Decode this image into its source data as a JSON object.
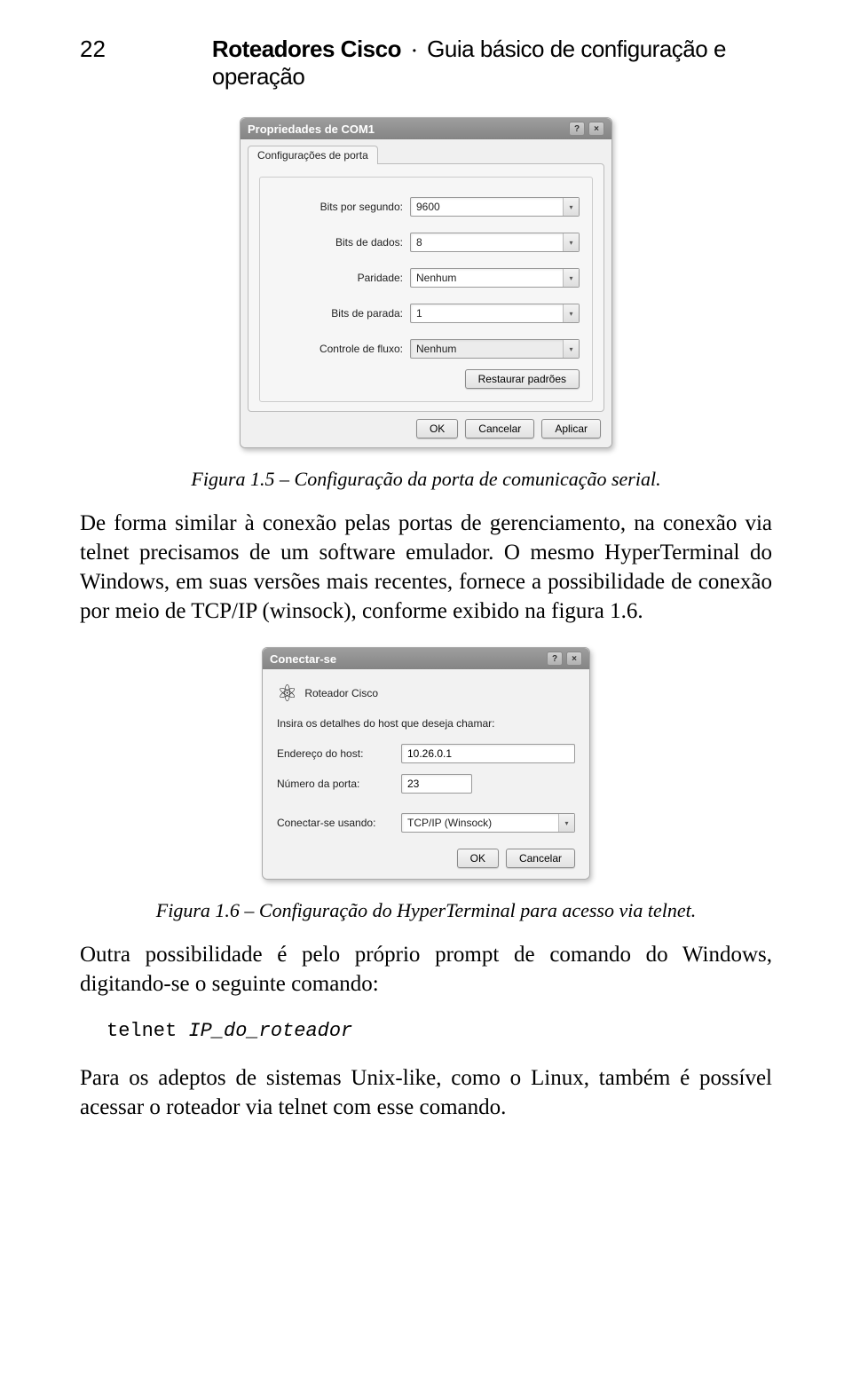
{
  "header": {
    "page_number": "22",
    "book_title_left": "Roteadores Cisco",
    "separator": "•",
    "book_title_right": "Guia básico de configuração e operação"
  },
  "dialog1": {
    "title": "Propriedades de COM1",
    "help_btn": "?",
    "close_btn": "×",
    "tab_label": "Configurações de porta",
    "fields": {
      "bits_per_second_label": "Bits por segundo:",
      "bits_per_second_value": "9600",
      "data_bits_label": "Bits de dados:",
      "data_bits_value": "8",
      "parity_label": "Paridade:",
      "parity_value": "Nenhum",
      "stop_bits_label": "Bits de parada:",
      "stop_bits_value": "1",
      "flow_control_label": "Controle de fluxo:",
      "flow_control_value": "Nenhum"
    },
    "restore_btn": "Restaurar padrões",
    "ok_btn": "OK",
    "cancel_btn": "Cancelar",
    "apply_btn": "Aplicar"
  },
  "caption1": "Figura 1.5 – Configuração da porta de comunicação serial.",
  "para1": "De forma similar à conexão pelas portas de gerenciamento, na conexão via telnet precisamos de um software emulador. O mesmo HyperTerminal do Windows, em suas versões mais recentes, fornece a possibilidade de conexão por meio de TCP/IP (winsock), conforme exibido na figura 1.6.",
  "dialog2": {
    "title": "Conectar-se",
    "help_btn": "?",
    "close_btn": "×",
    "conn_name": "Roteador Cisco",
    "instruction": "Insira os detalhes do host que deseja chamar:",
    "host_label": "Endereço do host:",
    "host_value": "10.26.0.1",
    "port_label": "Número da porta:",
    "port_value": "23",
    "connect_using_label": "Conectar-se usando:",
    "connect_using_value": "TCP/IP (Winsock)",
    "ok_btn": "OK",
    "cancel_btn": "Cancelar"
  },
  "caption2": "Figura 1.6 – Configuração do HyperTerminal para acesso via telnet.",
  "para2": "Outra possibilidade é pelo próprio prompt de comando do Windows, digitando-se o seguinte comando:",
  "code": {
    "cmd": "telnet",
    "arg": "IP_do_roteador"
  },
  "para3": "Para os adeptos de sistemas Unix-like, como o Linux, também é possível acessar o roteador via telnet com esse comando."
}
